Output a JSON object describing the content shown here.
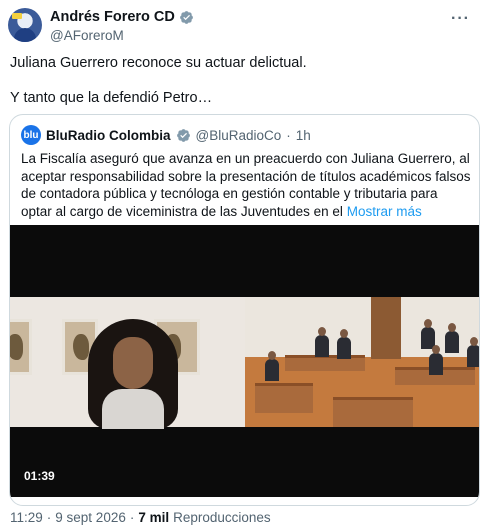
{
  "author": {
    "name": "Andrés Forero CD",
    "handle": "@AForeroM"
  },
  "menu_icon": "more-horizontal-icon",
  "tweet": {
    "line1": "Juliana Guerrero reconoce su actuar delictual.",
    "line2": "Y tanto que la defendió Petro…"
  },
  "quoted": {
    "name": "BluRadio Colombia",
    "avatar_text": "blu",
    "handle": "@BluRadioCo",
    "separator": "·",
    "time": "1h",
    "text": "La Fiscalía aseguró que avanza en un preacuerdo con Juliana Guerrero, al aceptar responsabilidad sobre la presentación de títulos académicos falsos de contadora pública y tecnóloga en gestión contable y tributaria para optar al cargo de viceministra de las Juventudes en el",
    "show_more": "Mostrar más",
    "video_duration": "01:39"
  },
  "meta": {
    "time": "11:29",
    "separator": "·",
    "date": "9 sept 2026",
    "views": "7 mil",
    "views_label": "Reproducciones"
  },
  "colors": {
    "accent": "#1d9bf0",
    "verified_badge": "#829aab",
    "muted": "#536471"
  }
}
